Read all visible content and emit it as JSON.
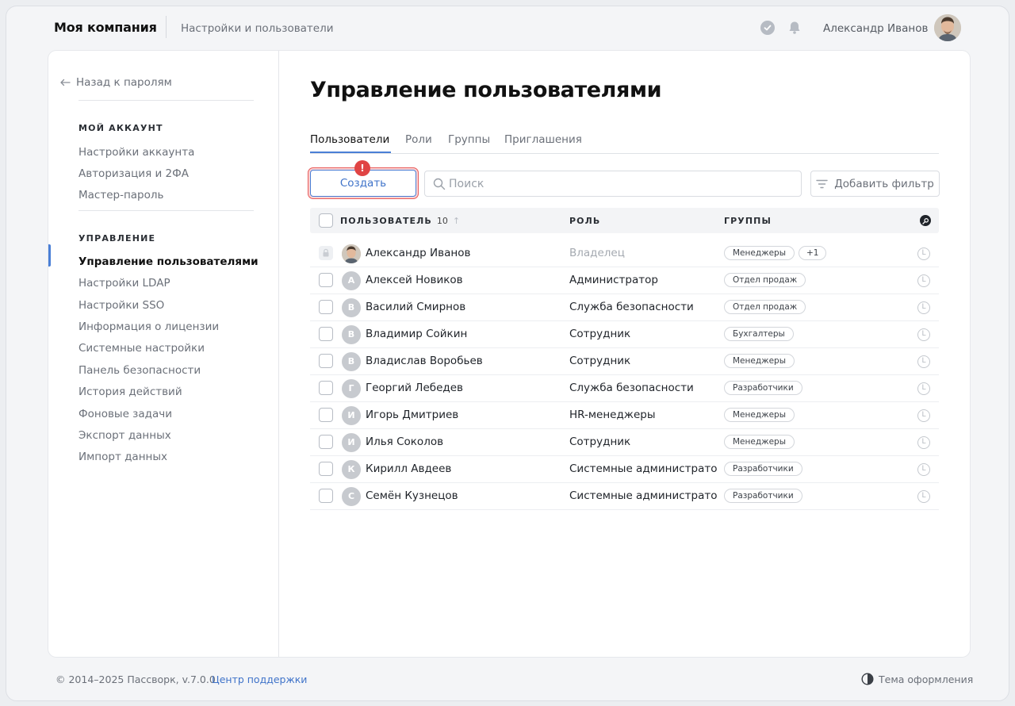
{
  "header": {
    "brand": "Моя компания",
    "subtitle": "Настройки и пользователи",
    "user_name": "Александр Иванов"
  },
  "sidebar": {
    "back_label": "Назад к паролям",
    "sections": [
      {
        "title": "МОЙ АККАУНТ",
        "items": [
          "Настройки аккаунта",
          "Авторизация и 2ФА",
          "Мастер-пароль"
        ]
      },
      {
        "title": "УПРАВЛЕНИЕ",
        "items": [
          "Управление пользователями",
          "Настройки LDAP",
          "Настройки SSO",
          "Информация о лицензии",
          "Системные настройки",
          "Панель безопасности",
          "История действий",
          "Фоновые задачи",
          "Экспорт данных",
          "Импорт данных"
        ]
      }
    ],
    "active_item": "Управление пользователями"
  },
  "main": {
    "title": "Управление пользователями",
    "tabs": [
      "Пользователи",
      "Роли",
      "Группы",
      "Приглашения"
    ],
    "active_tab": "Пользователи",
    "create_label": "Создать",
    "error_badge": "!",
    "search_placeholder": "Поиск",
    "filter_label": "Добавить фильтр"
  },
  "table": {
    "columns": {
      "user": "ПОЛЬЗОВАТЕЛЬ",
      "user_count": "10",
      "role": "РОЛЬ",
      "groups": "ГРУППЫ"
    },
    "rows": [
      {
        "initial": "",
        "name": "Александр Иванов",
        "role": "Владелец",
        "groups": [
          "Менеджеры",
          "+1"
        ],
        "locked": true
      },
      {
        "initial": "А",
        "name": "Алексей Новиков",
        "role": "Администратор",
        "groups": [
          "Отдел продаж"
        ]
      },
      {
        "initial": "В",
        "name": "Василий Смирнов",
        "role": "Служба безопасности",
        "groups": [
          "Отдел продаж"
        ]
      },
      {
        "initial": "В",
        "name": "Владимир Сойкин",
        "role": "Сотрудник",
        "groups": [
          "Бухгалтеры"
        ]
      },
      {
        "initial": "В",
        "name": "Владислав Воробьев",
        "role": "Сотрудник",
        "groups": [
          "Менеджеры"
        ]
      },
      {
        "initial": "Г",
        "name": "Георгий Лебедев",
        "role": "Служба безопасности",
        "groups": [
          "Разработчики"
        ]
      },
      {
        "initial": "И",
        "name": "Игорь Дмитриев",
        "role": "HR-менеджеры",
        "groups": [
          "Менеджеры"
        ]
      },
      {
        "initial": "И",
        "name": "Илья Соколов",
        "role": "Сотрудник",
        "groups": [
          "Менеджеры"
        ]
      },
      {
        "initial": "К",
        "name": "Кирилл Авдеев",
        "role": "Системные администраторы",
        "groups": [
          "Разработчики"
        ]
      },
      {
        "initial": "С",
        "name": "Семён Кузнецов",
        "role": "Системные администраторы",
        "groups": [
          "Разработчики"
        ]
      }
    ]
  },
  "footer": {
    "copyright": "© 2014–2025 Пассворк, v.7.0.0",
    "support_link": "Центр поддержки",
    "theme_label": "Тема оформления"
  },
  "colors": {
    "accent": "#4a7fd6",
    "error": "#e04444"
  },
  "icons": {
    "back": "arrow-left-icon",
    "status": "check-circle-icon",
    "notifications": "bell-icon",
    "search": "search-icon",
    "filter": "filter-icon",
    "sort": "sort-arrow-up-icon",
    "column_settings": "key-icon",
    "row_action": "clock-icon",
    "lock": "lock-icon",
    "theme": "half-circle-icon"
  }
}
